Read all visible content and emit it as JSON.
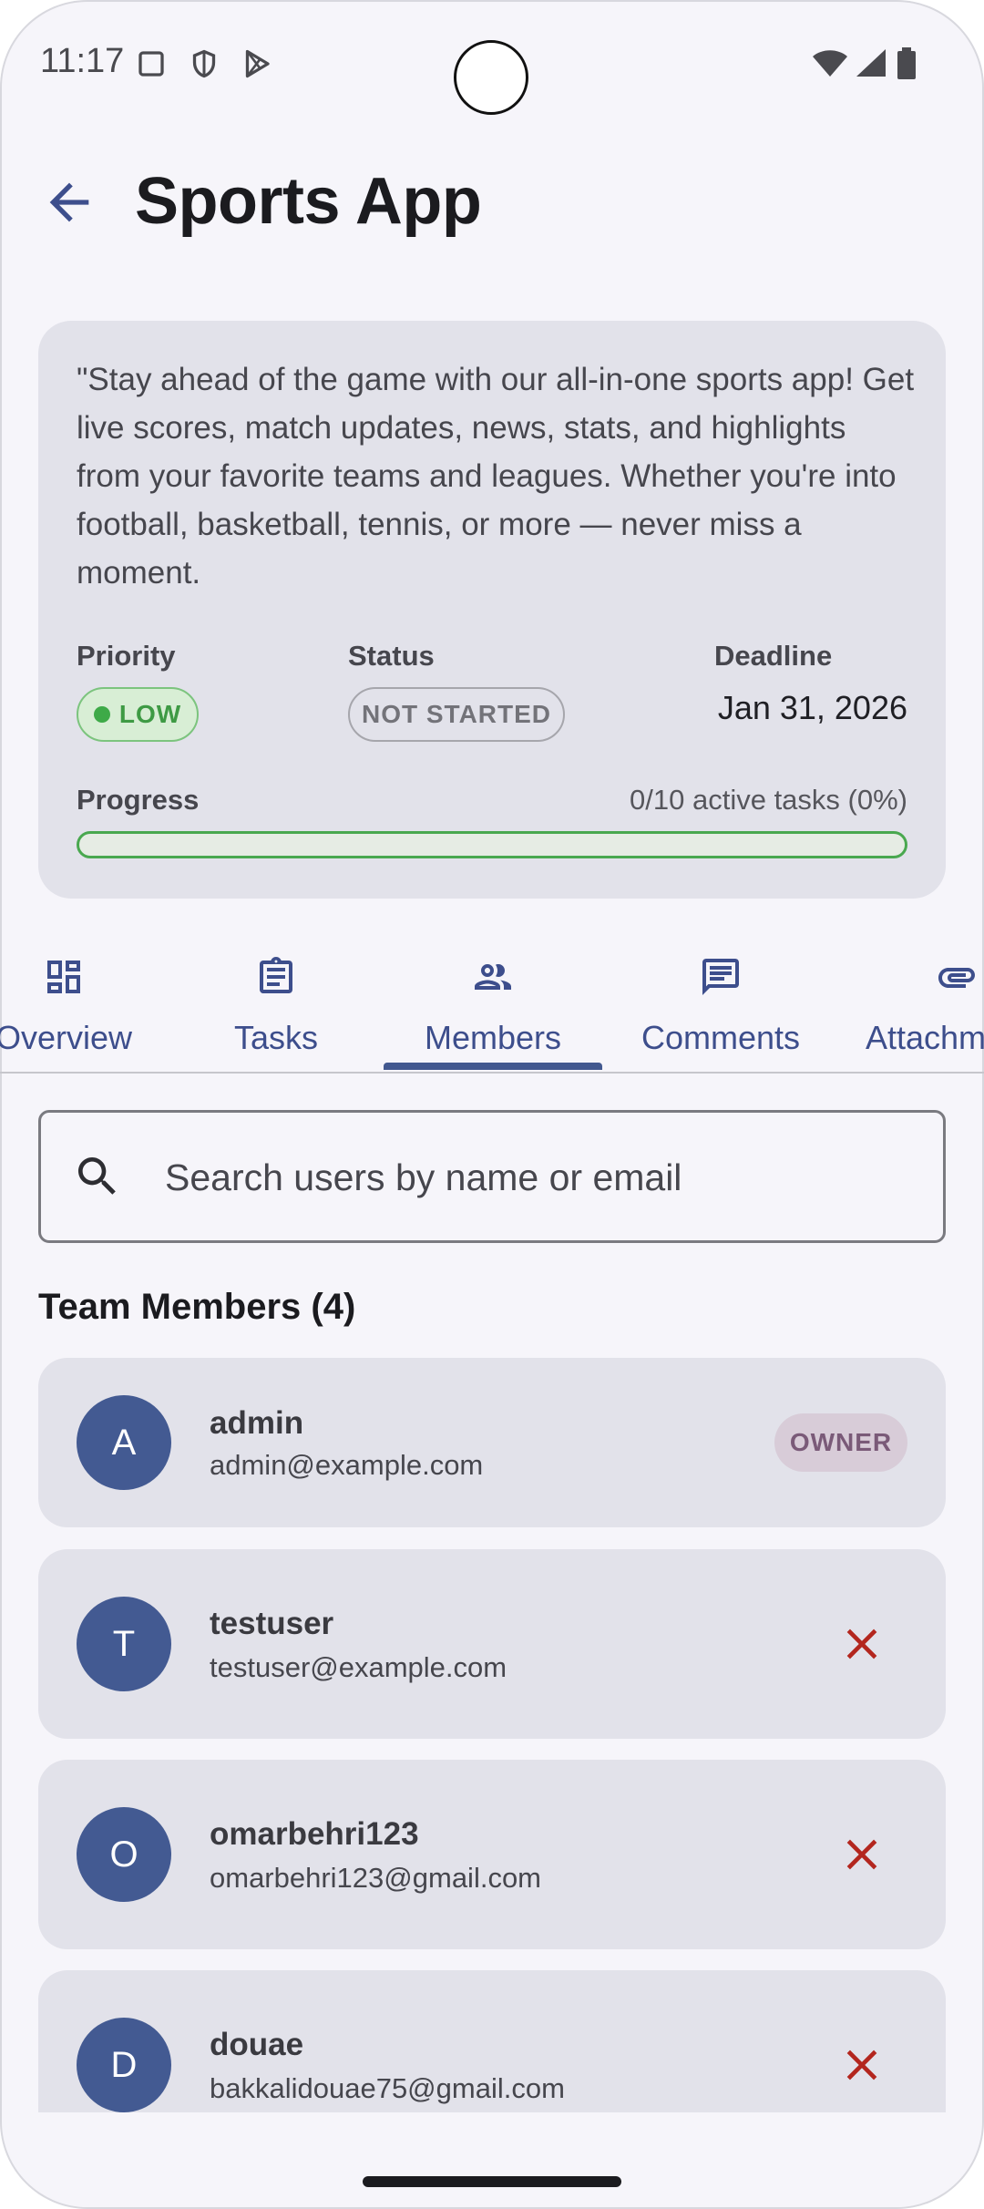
{
  "status_bar": {
    "time": "11:17"
  },
  "header": {
    "title": "Sports App",
    "back_label": "Back"
  },
  "project": {
    "description": "\"Stay ahead of the game with our all-in-one sports app! Get live scores, match updates, news, stats, and highlights from your favorite teams and leagues. Whether you're into football, basketball, tennis, or more — never miss a moment.",
    "priority_label": "Priority",
    "priority_value": "LOW",
    "status_label": "Status",
    "status_value": "NOT STARTED",
    "deadline_label": "Deadline",
    "deadline_value": "Jan 31, 2026",
    "progress_label": "Progress",
    "progress_text": "0/10 active tasks (0%)",
    "progress_fraction": 0
  },
  "tabs": [
    {
      "label": "Overview",
      "icon": "dashboard-icon"
    },
    {
      "label": "Tasks",
      "icon": "clipboard-icon"
    },
    {
      "label": "Members",
      "icon": "people-icon",
      "selected": true
    },
    {
      "label": "Comments",
      "icon": "comment-icon"
    },
    {
      "label": "Attachments",
      "icon": "paperclip-icon"
    }
  ],
  "search": {
    "placeholder": "Search users by name or email"
  },
  "members": {
    "title": "Team Members (4)",
    "owner_badge": "OWNER",
    "list": [
      {
        "initial": "A",
        "name": "admin",
        "email": "admin@example.com"
      },
      {
        "initial": "T",
        "name": "testuser",
        "email": "testuser@example.com"
      },
      {
        "initial": "O",
        "name": "omarbehri123",
        "email": "omarbehri123@gmail.com"
      },
      {
        "initial": "D",
        "name": "douae",
        "email": "bakkalidouae75@gmail.com"
      }
    ]
  },
  "colors": {
    "accent": "#42588f",
    "avatar": "#435a92",
    "remove": "#b3261e",
    "low_priority": "#3eaa48"
  }
}
